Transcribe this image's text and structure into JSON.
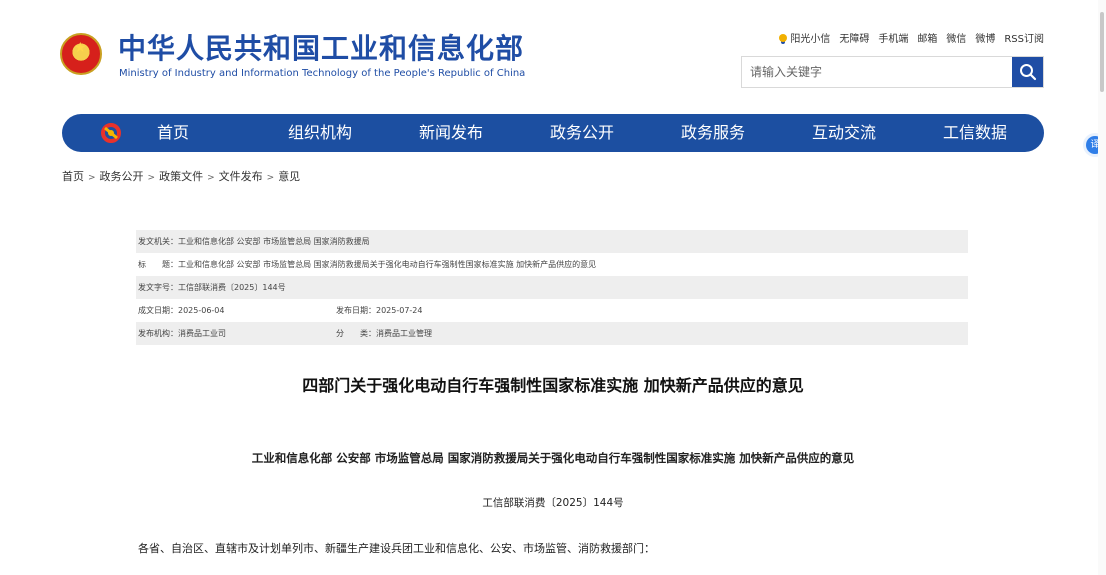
{
  "header": {
    "site_name_cn": "中华人民共和国工业和信息化部",
    "site_name_en": "Ministry of Industry and Information Technology of the People's Republic of China",
    "top_links": [
      "阳光小信",
      "无障碍",
      "手机端",
      "邮箱",
      "微信",
      "微博",
      "RSS订阅"
    ],
    "search_placeholder": "请输入关键字"
  },
  "nav": {
    "items": [
      "首页",
      "组织机构",
      "新闻发布",
      "政务公开",
      "政务服务",
      "互动交流",
      "工信数据"
    ]
  },
  "side_badge": "译",
  "breadcrumb": [
    "首页",
    "政务公开",
    "政策文件",
    "文件发布",
    "意见"
  ],
  "breadcrumb_sep": ">",
  "meta": {
    "issuer": "发文机关：工业和信息化部 公安部 市场监管总局 国家消防救援局",
    "title": "标　　题：工业和信息化部 公安部 市场监管总局 国家消防救援局关于强化电动自行车强制性国家标准实施 加快新产品供应的意见",
    "doc_number": "发文字号：工信部联消费〔2025〕144号",
    "created": "成文日期：2025-06-04",
    "published": "发布日期：2025-07-24",
    "org": "发布机构：消费品工业司",
    "category": "分　　类：消费品工业管理"
  },
  "article": {
    "title": "四部门关于强化电动自行车强制性国家标准实施 加快新产品供应的意见",
    "subtitle": "工业和信息化部 公安部 市场监管总局 国家消防救援局关于强化电动自行车强制性国家标准实施 加快新产品供应的意见",
    "doc_number": "工信部联消费〔2025〕144号",
    "salutation": "各省、自治区、直辖市及计划单列市、新疆生产建设兵团工业和信息化、公安、市场监管、消防救援部门："
  },
  "colors": {
    "brand_blue": "#1c4fa1",
    "meta_row_bg": "#eeeeee"
  }
}
